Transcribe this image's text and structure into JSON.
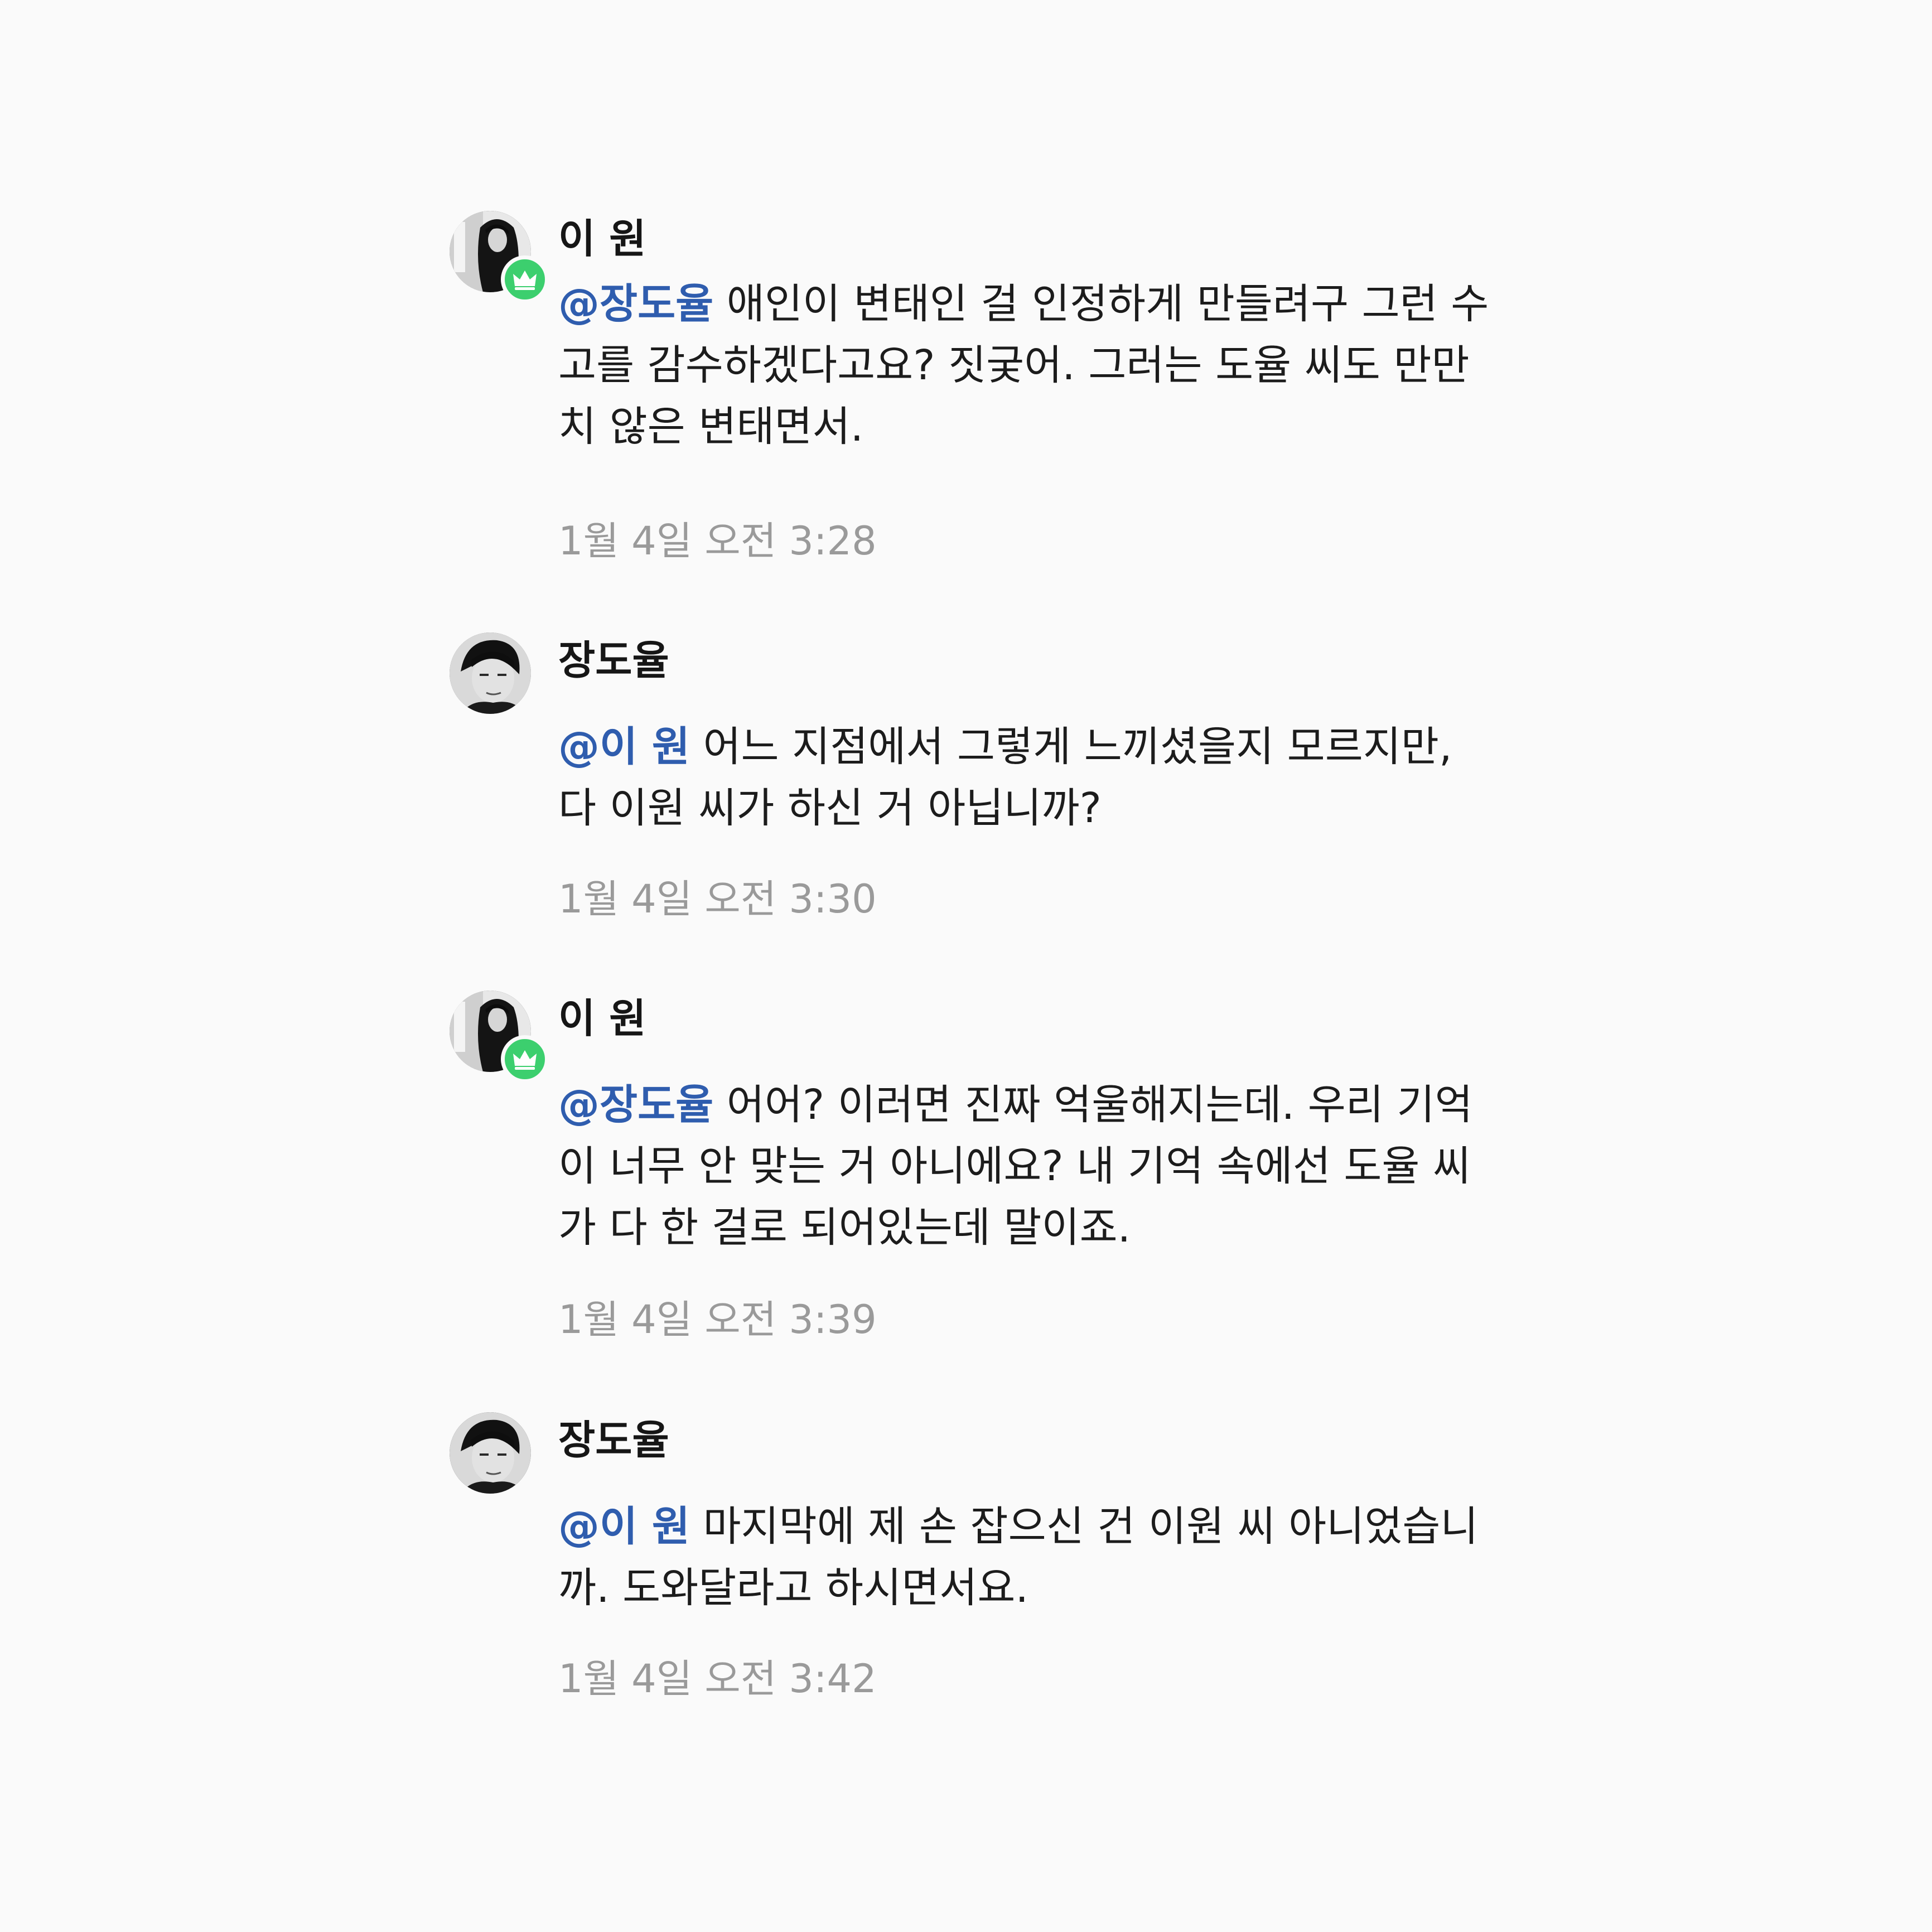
{
  "messages": [
    {
      "sender": "이 원",
      "avatar_icon": "profile-photo-woman",
      "badge_icon": "crown-icon",
      "mention": "@장도율",
      "text": " 애인이 변태인 걸 인정하게 만들려구 그런 수고를 감수하겠다고요? 짓궂어. 그러는 도율 씨도 만만치 않은 변태면서.",
      "timestamp": "1월 4일 오전 3:28"
    },
    {
      "sender": "장도율",
      "avatar_icon": "profile-photo-man",
      "mention": "@이 원",
      "text": " 어느 지점에서 그렇게 느끼셨을지 모르지만, 다 이원 씨가 하신 거 아닙니까?",
      "timestamp": "1월 4일 오전 3:30"
    },
    {
      "sender": "이 원",
      "avatar_icon": "profile-photo-woman",
      "badge_icon": "crown-icon",
      "mention": "@장도율",
      "text": " 어어? 이러면 진짜 억울해지는데. 우리 기억이 너무 안 맞는 거 아니에요? 내 기억 속에선 도율 씨가 다 한 걸로 되어있는데 말이죠.",
      "timestamp": "1월 4일 오전 3:39"
    },
    {
      "sender": "장도율",
      "avatar_icon": "profile-photo-man",
      "mention": "@이 원",
      "text": " 마지막에 제 손 잡으신 건 이원 씨 아니었습니까. 도와달라고 하시면서요.",
      "timestamp": "1월 4일 오전 3:42"
    }
  ],
  "colors": {
    "background": "#fafafa",
    "mention": "#2f5dae",
    "timestamp": "#9a9a9a",
    "badge": "#3ccf6e"
  }
}
